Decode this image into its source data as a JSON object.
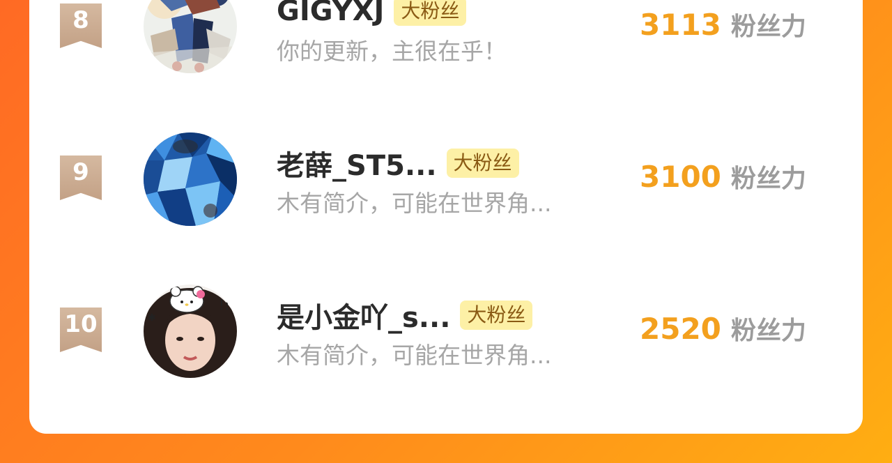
{
  "ranking": {
    "rows": [
      {
        "rank": "8",
        "name": "GIGYXJ",
        "badge": "大粉丝",
        "bio": "你的更新，主很在乎！",
        "score": "3113",
        "score_unit": "粉丝力",
        "avatar_icon": "anime-character-avatar"
      },
      {
        "rank": "9",
        "name": "老薛_ST5...",
        "badge": "大粉丝",
        "bio": "木有简介，可能在世界角...",
        "score": "3100",
        "score_unit": "粉丝力",
        "avatar_icon": "blue-shattered-art-avatar"
      },
      {
        "rank": "10",
        "name": "是小金吖_s...",
        "badge": "大粉丝",
        "bio": "木有简介，可能在世界角...",
        "score": "2520",
        "score_unit": "粉丝力",
        "avatar_icon": "girl-with-hello-kitty-headband-avatar"
      }
    ]
  },
  "colors": {
    "background_gradient_start": "#ff6a24",
    "background_gradient_end": "#ffae12",
    "score_color": "#f3a01e",
    "badge_bg": "#fdf0a6",
    "rank_ribbon": "#c8a78c"
  }
}
